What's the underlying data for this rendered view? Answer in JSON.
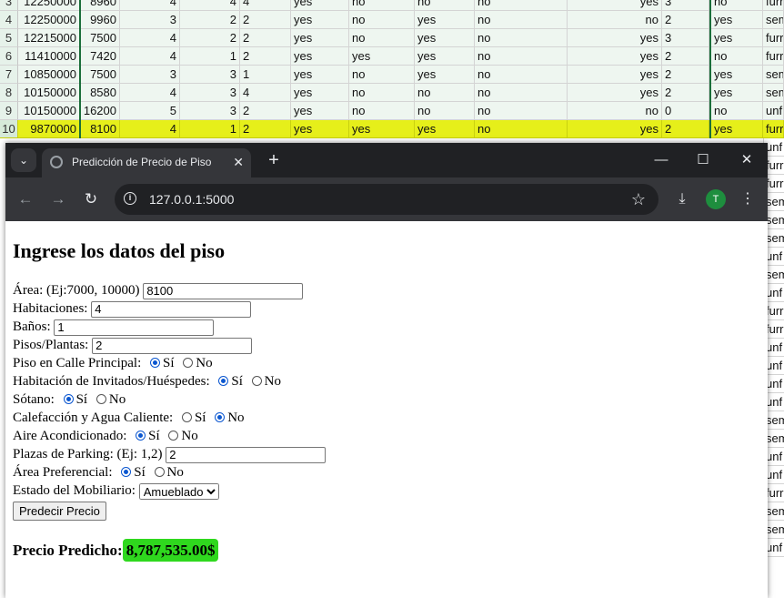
{
  "sheet": {
    "rows": [
      {
        "n": "3",
        "c": [
          "12250000",
          "8960",
          "4",
          "4",
          "4",
          "yes",
          "no",
          "no",
          "no",
          "yes",
          "3",
          "no",
          "furr"
        ]
      },
      {
        "n": "4",
        "c": [
          "12250000",
          "9960",
          "3",
          "2",
          "2",
          "yes",
          "no",
          "yes",
          "no",
          "no",
          "2",
          "yes",
          "sem"
        ]
      },
      {
        "n": "5",
        "c": [
          "12215000",
          "7500",
          "4",
          "2",
          "2",
          "yes",
          "no",
          "yes",
          "no",
          "yes",
          "3",
          "yes",
          "furr"
        ]
      },
      {
        "n": "6",
        "c": [
          "11410000",
          "7420",
          "4",
          "1",
          "2",
          "yes",
          "yes",
          "yes",
          "no",
          "yes",
          "2",
          "no",
          "furr"
        ]
      },
      {
        "n": "7",
        "c": [
          "10850000",
          "7500",
          "3",
          "3",
          "1",
          "yes",
          "no",
          "yes",
          "no",
          "yes",
          "2",
          "yes",
          "sem"
        ]
      },
      {
        "n": "8",
        "c": [
          "10150000",
          "8580",
          "4",
          "3",
          "4",
          "yes",
          "no",
          "no",
          "no",
          "yes",
          "2",
          "yes",
          "sem"
        ]
      },
      {
        "n": "9",
        "c": [
          "10150000",
          "16200",
          "5",
          "3",
          "2",
          "yes",
          "no",
          "no",
          "no",
          "no",
          "0",
          "no",
          "unf"
        ]
      },
      {
        "n": "10",
        "c": [
          "9870000",
          "8100",
          "4",
          "1",
          "2",
          "yes",
          "yes",
          "yes",
          "no",
          "yes",
          "2",
          "yes",
          "furr"
        ]
      }
    ],
    "right_col": [
      "unf",
      "furr",
      "furr",
      "sem",
      "sem",
      "sem",
      "unf",
      "sem",
      "unf",
      "furr",
      "furr",
      "unf",
      "unf",
      "unf",
      "unf",
      "sem",
      "sem",
      "unf",
      "unf",
      "furr",
      "sem",
      "sem",
      "unf"
    ],
    "highlight_color": "#e6ef1a"
  },
  "browser": {
    "tab_title": "Predicción de Precio de Piso",
    "url": "127.0.0.1:5000",
    "avatar_letter": "T",
    "icons": {
      "tab_menu": "chevron-down-icon",
      "favicon": "globe-icon",
      "tab_close": "close-icon",
      "new_tab": "plus-icon",
      "minimize": "minimize-icon",
      "maximize": "maximize-icon",
      "window_close": "close-icon",
      "back": "arrow-left-icon",
      "forward": "arrow-right-icon",
      "reload": "reload-icon",
      "site_info": "info-icon",
      "bookmark": "star-icon",
      "download": "download-icon",
      "menu": "more-vert-icon"
    }
  },
  "page": {
    "heading": "Ingrese los datos del piso",
    "fields": {
      "area_label": "Área: (Ej:7000, 10000)",
      "area_value": "8100",
      "bedrooms_label": "Habitaciones:",
      "bedrooms_value": "4",
      "bathrooms_label": "Baños:",
      "bathrooms_value": "1",
      "stories_label": "Pisos/Plantas:",
      "stories_value": "2",
      "mainroad_label": "Piso en Calle Principal:",
      "guestroom_label": "Habitación de Invitados/Huéspedes:",
      "basement_label": "Sótano:",
      "hotwater_label": "Calefacción y Agua Caliente:",
      "aircon_label": "Aire Acondicionado:",
      "parking_label": "Plazas de Parking: (Ej: 1,2)",
      "parking_value": "2",
      "prefarea_label": "Área Preferencial:",
      "furnishing_label": "Estado del Mobiliario:",
      "furnishing_value": "Amueblado",
      "yes": "Sí",
      "no": "No"
    },
    "radios": {
      "mainroad": "yes",
      "guestroom": "yes",
      "basement": "yes",
      "hotwater": "no",
      "aircon": "yes",
      "prefarea": "yes"
    },
    "submit_label": "Predecir Precio",
    "result_label": "Precio Predicho:",
    "result_value": "8,787,535.00$",
    "result_highlight": "#2fd81e"
  }
}
